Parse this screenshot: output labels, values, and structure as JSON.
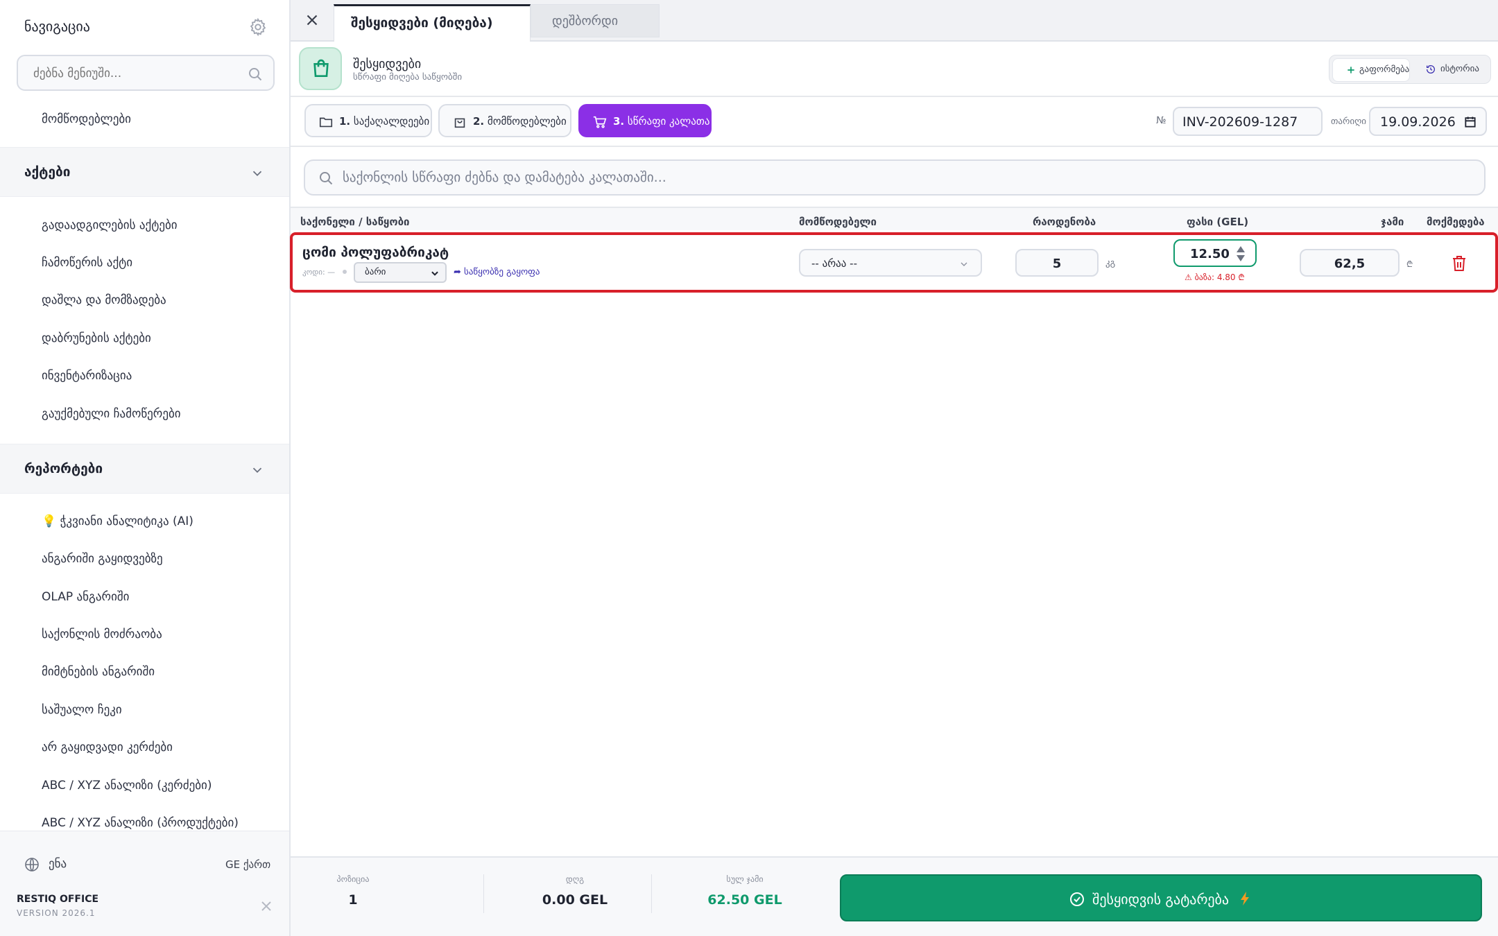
{
  "sidebar": {
    "title": "ნავიგაცია",
    "search_placeholder": "ძებნა მენიუში...",
    "top_item": "მომწოდებლები",
    "acts_section": "აქტები",
    "acts_items": [
      "გადაადგილების აქტები",
      "ჩამოწერის აქტი",
      "დაშლა და მომზადება",
      "დაბრუნების აქტები",
      "ინვენტარიზაცია",
      "გაუქმებული ჩამოწერები"
    ],
    "reports_section": "რეპორტები",
    "reports_items": [
      "💡 ჭკვიანი ანალიტიკა (AI)",
      "ანგარიში გაყიდვებზე",
      "OLAP ანგარიში",
      "საქონლის მოძრაობა",
      "მიმტნების ანგარიში",
      "საშუალო ჩეკი",
      "არ გაყიდვადი კერძები",
      "ABC / XYZ ანალიზი (კერძები)",
      "ABC / XYZ ანალიზი (პროდუქტები)"
    ],
    "lang_label": "ენა",
    "lang_value": "GE ქართ",
    "brand": "RESTIQ OFFICE",
    "version": "VERSION 2026.1"
  },
  "tabs": [
    {
      "label": "შესყიდვები (მიღება)",
      "active": true
    },
    {
      "label": "დეშბორდი",
      "active": false
    }
  ],
  "header": {
    "title": "შესყიდვები",
    "subtitle": "სწრაფი მიღება საწყობში",
    "expand_label": "გაფორმება",
    "history_label": "ისტორია"
  },
  "steps": [
    {
      "num": "1.",
      "label": "საქაღალდეები"
    },
    {
      "num": "2.",
      "label": "მომწოდებლები"
    },
    {
      "num": "3.",
      "label": "სწრაფი კალათა"
    }
  ],
  "invoice": {
    "no_label": "№",
    "number": "INV-202609-1287",
    "date_label": "თარიღი",
    "date": "19.09.2026"
  },
  "product_search_placeholder": "საქონლის სწრაფი ძებნა და დამატება კალათაში...",
  "table": {
    "headers": {
      "product": "საქონელი / საწყობი",
      "supplier": "მომწოდებელი",
      "qty": "რაოდენობა",
      "price": "ფასი (GEL)",
      "sum": "ჯამი",
      "action": "მოქმედება"
    },
    "rows": [
      {
        "name": "ცომი პოლუფაბრიკატ",
        "code": "კოდი: —",
        "warehouse": "ბარი",
        "move_link": "➦ საწყობზე გაყოფა",
        "supplier": "-- არაა --",
        "qty": "5",
        "unit": "კგ",
        "price": "12.50",
        "warning": "⚠ ბაზა: 4.80 ₾",
        "sum": "62,5",
        "currency": "₾"
      }
    ]
  },
  "footer": {
    "positions_label": "პოზიცია",
    "positions_value": "1",
    "vat_label": "დღგ",
    "vat_value": "0.00 GEL",
    "total_label": "სულ ჯამი",
    "total_value": "62.50 GEL",
    "submit_label": "შესყიდვის გატარება"
  },
  "colors": {
    "accent_purple": "#8b2fe6",
    "success_green": "#0f9a6c",
    "highlight_red": "#d8202a"
  }
}
